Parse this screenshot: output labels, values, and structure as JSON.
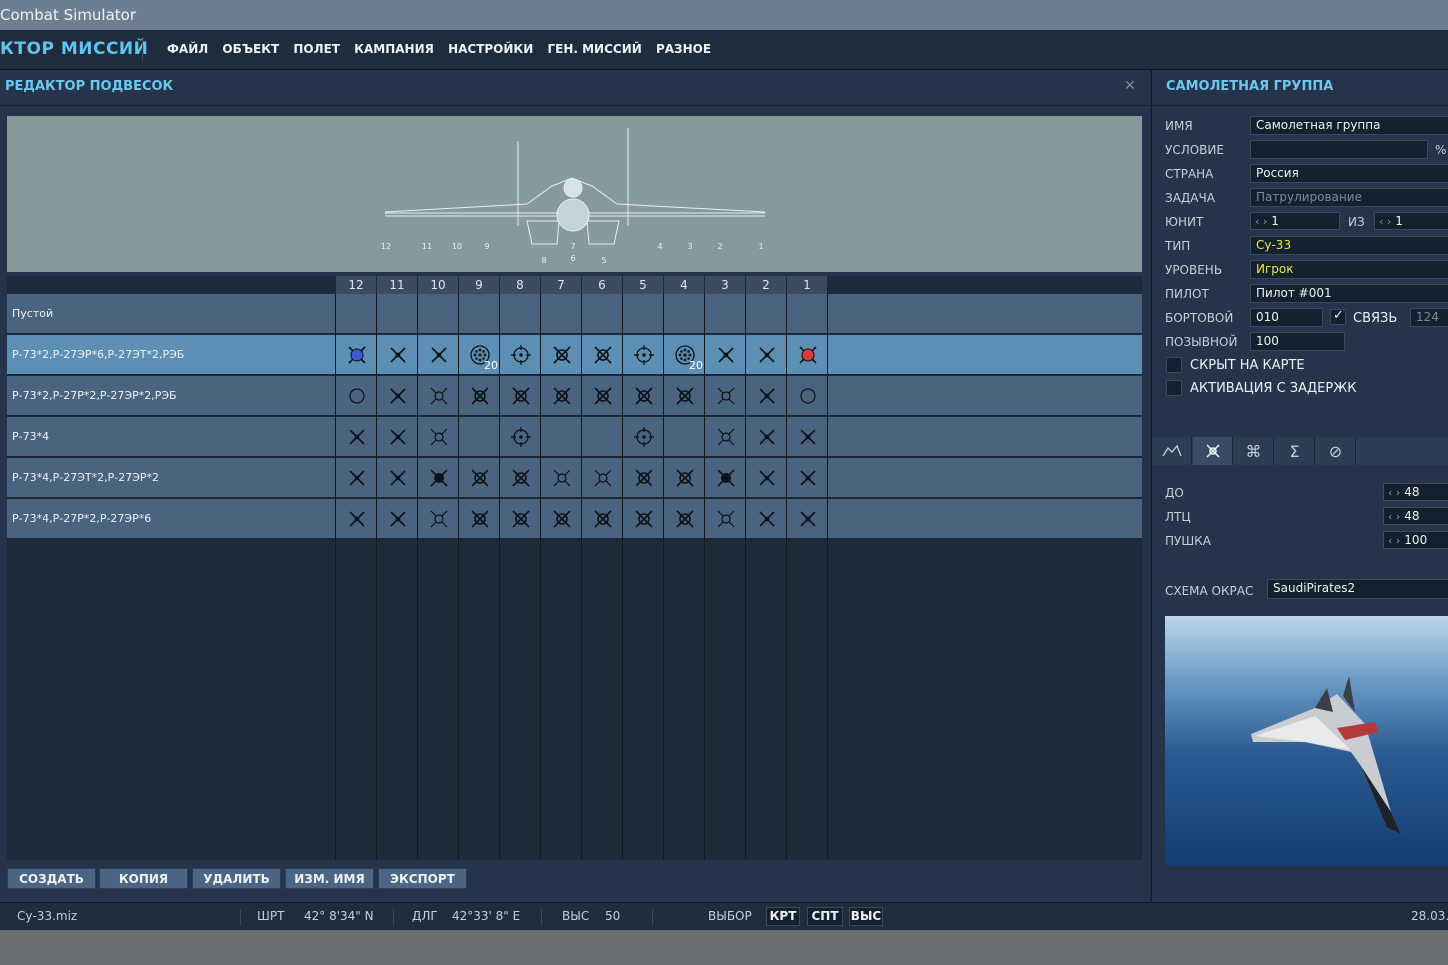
{
  "window": {
    "title": "Combat Simulator"
  },
  "menu": {
    "app_title": "КТОР МИССИЙ",
    "items": [
      "ФАЙЛ",
      "ОБЪЕКТ",
      "ПОЛЕТ",
      "КАМПАНИЯ",
      "НАСТРОЙКИ",
      "ГЕН. МИССИЙ",
      "РАЗНОЕ"
    ]
  },
  "loadout": {
    "title": "РЕДАКТОР ПОДВЕСОК",
    "close_icon": "close-icon",
    "preview_labels": [
      "12",
      "11",
      "10",
      "9",
      "8",
      "7",
      "6",
      "5",
      "4",
      "3",
      "2",
      "1"
    ],
    "pylons": [
      "12",
      "11",
      "10",
      "9",
      "8",
      "7",
      "6",
      "5",
      "4",
      "3",
      "2",
      "1"
    ],
    "rows": [
      {
        "name": "Пустой",
        "cells": [
          "",
          "",
          "",
          "",
          "",
          "",
          "",
          "",
          "",
          "",
          "",
          ""
        ]
      },
      {
        "name": "Р-73*2,Р-27ЭР*6,Р-27ЭТ*2,РЭБ",
        "selected": true,
        "cells": [
          "blue",
          "x",
          "x",
          "rocket",
          "target",
          "xbig",
          "xbig",
          "target",
          "rocket",
          "x",
          "x",
          "red"
        ],
        "counts": {
          "3": "20",
          "8": "20"
        }
      },
      {
        "name": "Р-73*2,Р-27Р*2,Р-27ЭР*2,РЭБ",
        "cells": [
          "circle",
          "x",
          "xhollow",
          "xbig",
          "xbig",
          "xbig",
          "xbig",
          "xbig",
          "xbig",
          "xhollow",
          "x",
          "circle"
        ]
      },
      {
        "name": "Р-73*4",
        "cells": [
          "x",
          "x",
          "xhollow",
          "",
          "target",
          "",
          "",
          "target",
          "",
          "xhollow",
          "x",
          "x"
        ]
      },
      {
        "name": "Р-73*4,Р-27ЭТ*2,Р-27ЭР*2",
        "cells": [
          "x",
          "x",
          "xfill",
          "xbig",
          "xbig",
          "xhollow",
          "xhollow",
          "xbig",
          "xbig",
          "xfill",
          "x",
          "x"
        ]
      },
      {
        "name": "Р-73*4,Р-27Р*2,Р-27ЭР*6",
        "cells": [
          "x",
          "x",
          "xhollow",
          "xbig",
          "xbig",
          "xbig",
          "xbig",
          "xbig",
          "xbig",
          "xhollow",
          "x",
          "x"
        ]
      }
    ],
    "buttons": [
      "СОЗДАТЬ",
      "КОПИЯ",
      "УДАЛИТЬ",
      "ИЗМ. ИМЯ",
      "ЭКСПОРТ"
    ]
  },
  "group": {
    "title": "САМОЛЕТНАЯ ГРУППА",
    "name_label": "ИМЯ",
    "name_value": "Самолетная группа",
    "condition_label": "УСЛОВИЕ",
    "condition_value": "",
    "condition_unit": "%",
    "country_label": "СТРАНА",
    "country_value": "Россия",
    "task_label": "ЗАДАЧА",
    "task_value": "Патрулирование",
    "unit_label": "ЮНИТ",
    "unit_value": "1",
    "of_label": "ИЗ",
    "of_value": "1",
    "type_label": "ТИП",
    "type_value": "Су-33",
    "skill_label": "УРОВЕНЬ",
    "skill_value": "Игрок",
    "pilot_label": "ПИЛОТ",
    "pilot_value": "Пилот #001",
    "board_label": "БОРТОВОЙ",
    "board_value": "010",
    "link_label": "СВЯЗЬ",
    "link_value": "124",
    "callsign_label": "ПОЗЫВНОЙ",
    "callsign_value": "100",
    "hidden_label": "СКРЫТ НА КАРТЕ",
    "delay_label": "АКТИВАЦИЯ С ЗАДЕРЖК",
    "tabs": [
      "route-icon",
      "payload-icon",
      "systems-icon",
      "summary-icon",
      "prohibit-icon"
    ],
    "fuel_label": "ДО",
    "fuel_value": "48",
    "chaff_label": "ЛТЦ",
    "chaff_value": "48",
    "gun_label": "ПУШКА",
    "gun_value": "100",
    "livery_label": "СХЕМА ОКРАС",
    "livery_value": "SaudiPirates2"
  },
  "status": {
    "file": "Су-33.miz",
    "lat_label": "ШРТ",
    "lat_value": "42° 8'34\" N",
    "lon_label": "ДЛГ",
    "lon_value": "42°33' 8\" E",
    "alt_label": "ВЫС",
    "alt_value": "50",
    "select_label": "ВЫБОР",
    "btn_map": "КРТ",
    "btn_sat": "СПТ",
    "btn_alt": "ВЫС",
    "date": "28.03."
  }
}
